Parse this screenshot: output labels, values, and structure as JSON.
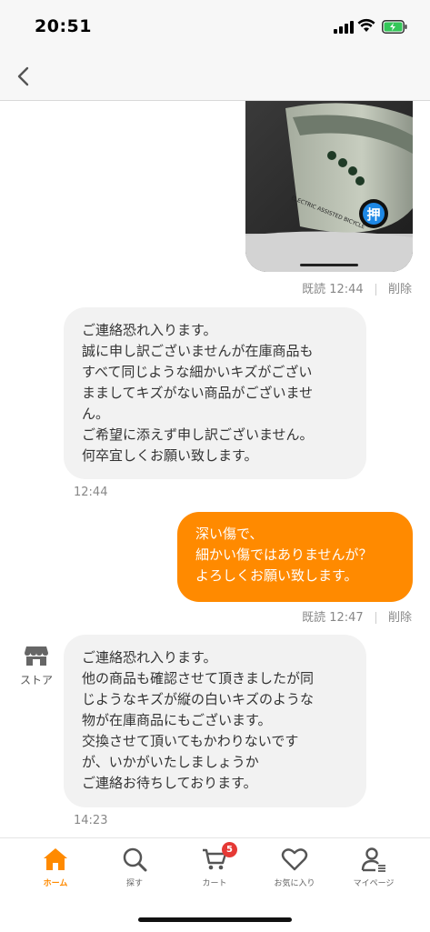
{
  "status_bar": {
    "time": "20:51"
  },
  "nav": {
    "back": "back"
  },
  "messages": {
    "img_meta": {
      "read": "既読",
      "time": "12:44",
      "delete": "削除"
    },
    "store1": {
      "text": "ご連絡恐れ入ります。\n誠に申し訳ございませんが在庫商品も\nすべて同じような細かいキズがござい\nまましてキズがない商品がございませ\nん。\nご希望に添えず申し訳ございません。\n何卒宜しくお願い致します。",
      "time": "12:44"
    },
    "user1": {
      "text": "深い傷で、\n細かい傷ではありませんが？\nよろしくお願い致します。",
      "read": "既読",
      "time": "12:47",
      "delete": "削除"
    },
    "store2": {
      "sender": "ストア",
      "text": "ご連絡恐れ入ります。\n他の商品も確認させて頂きましたが同\nじようなキズが縦の白いキズのような\n物が在庫商品にもございます。\n交換させて頂いてもかわりないです\nが、いかがいたしましょうか\nご連絡お待ちしております。",
      "time": "14:23"
    }
  },
  "image": {
    "device_text": "ELECTRIC ASSISTED BICYCLE",
    "button_char": "押"
  },
  "tab_bar": {
    "items": [
      {
        "label": "ホーム",
        "icon": "home-icon",
        "active": true
      },
      {
        "label": "探す",
        "icon": "search-icon"
      },
      {
        "label": "カート",
        "icon": "cart-icon",
        "badge": "5"
      },
      {
        "label": "お気に入り",
        "icon": "heart-icon"
      },
      {
        "label": "マイページ",
        "icon": "user-icon"
      }
    ]
  },
  "colors": {
    "accent": "#ff8a00",
    "bubble_gray": "#f2f2f2",
    "badge": "#e53935"
  }
}
